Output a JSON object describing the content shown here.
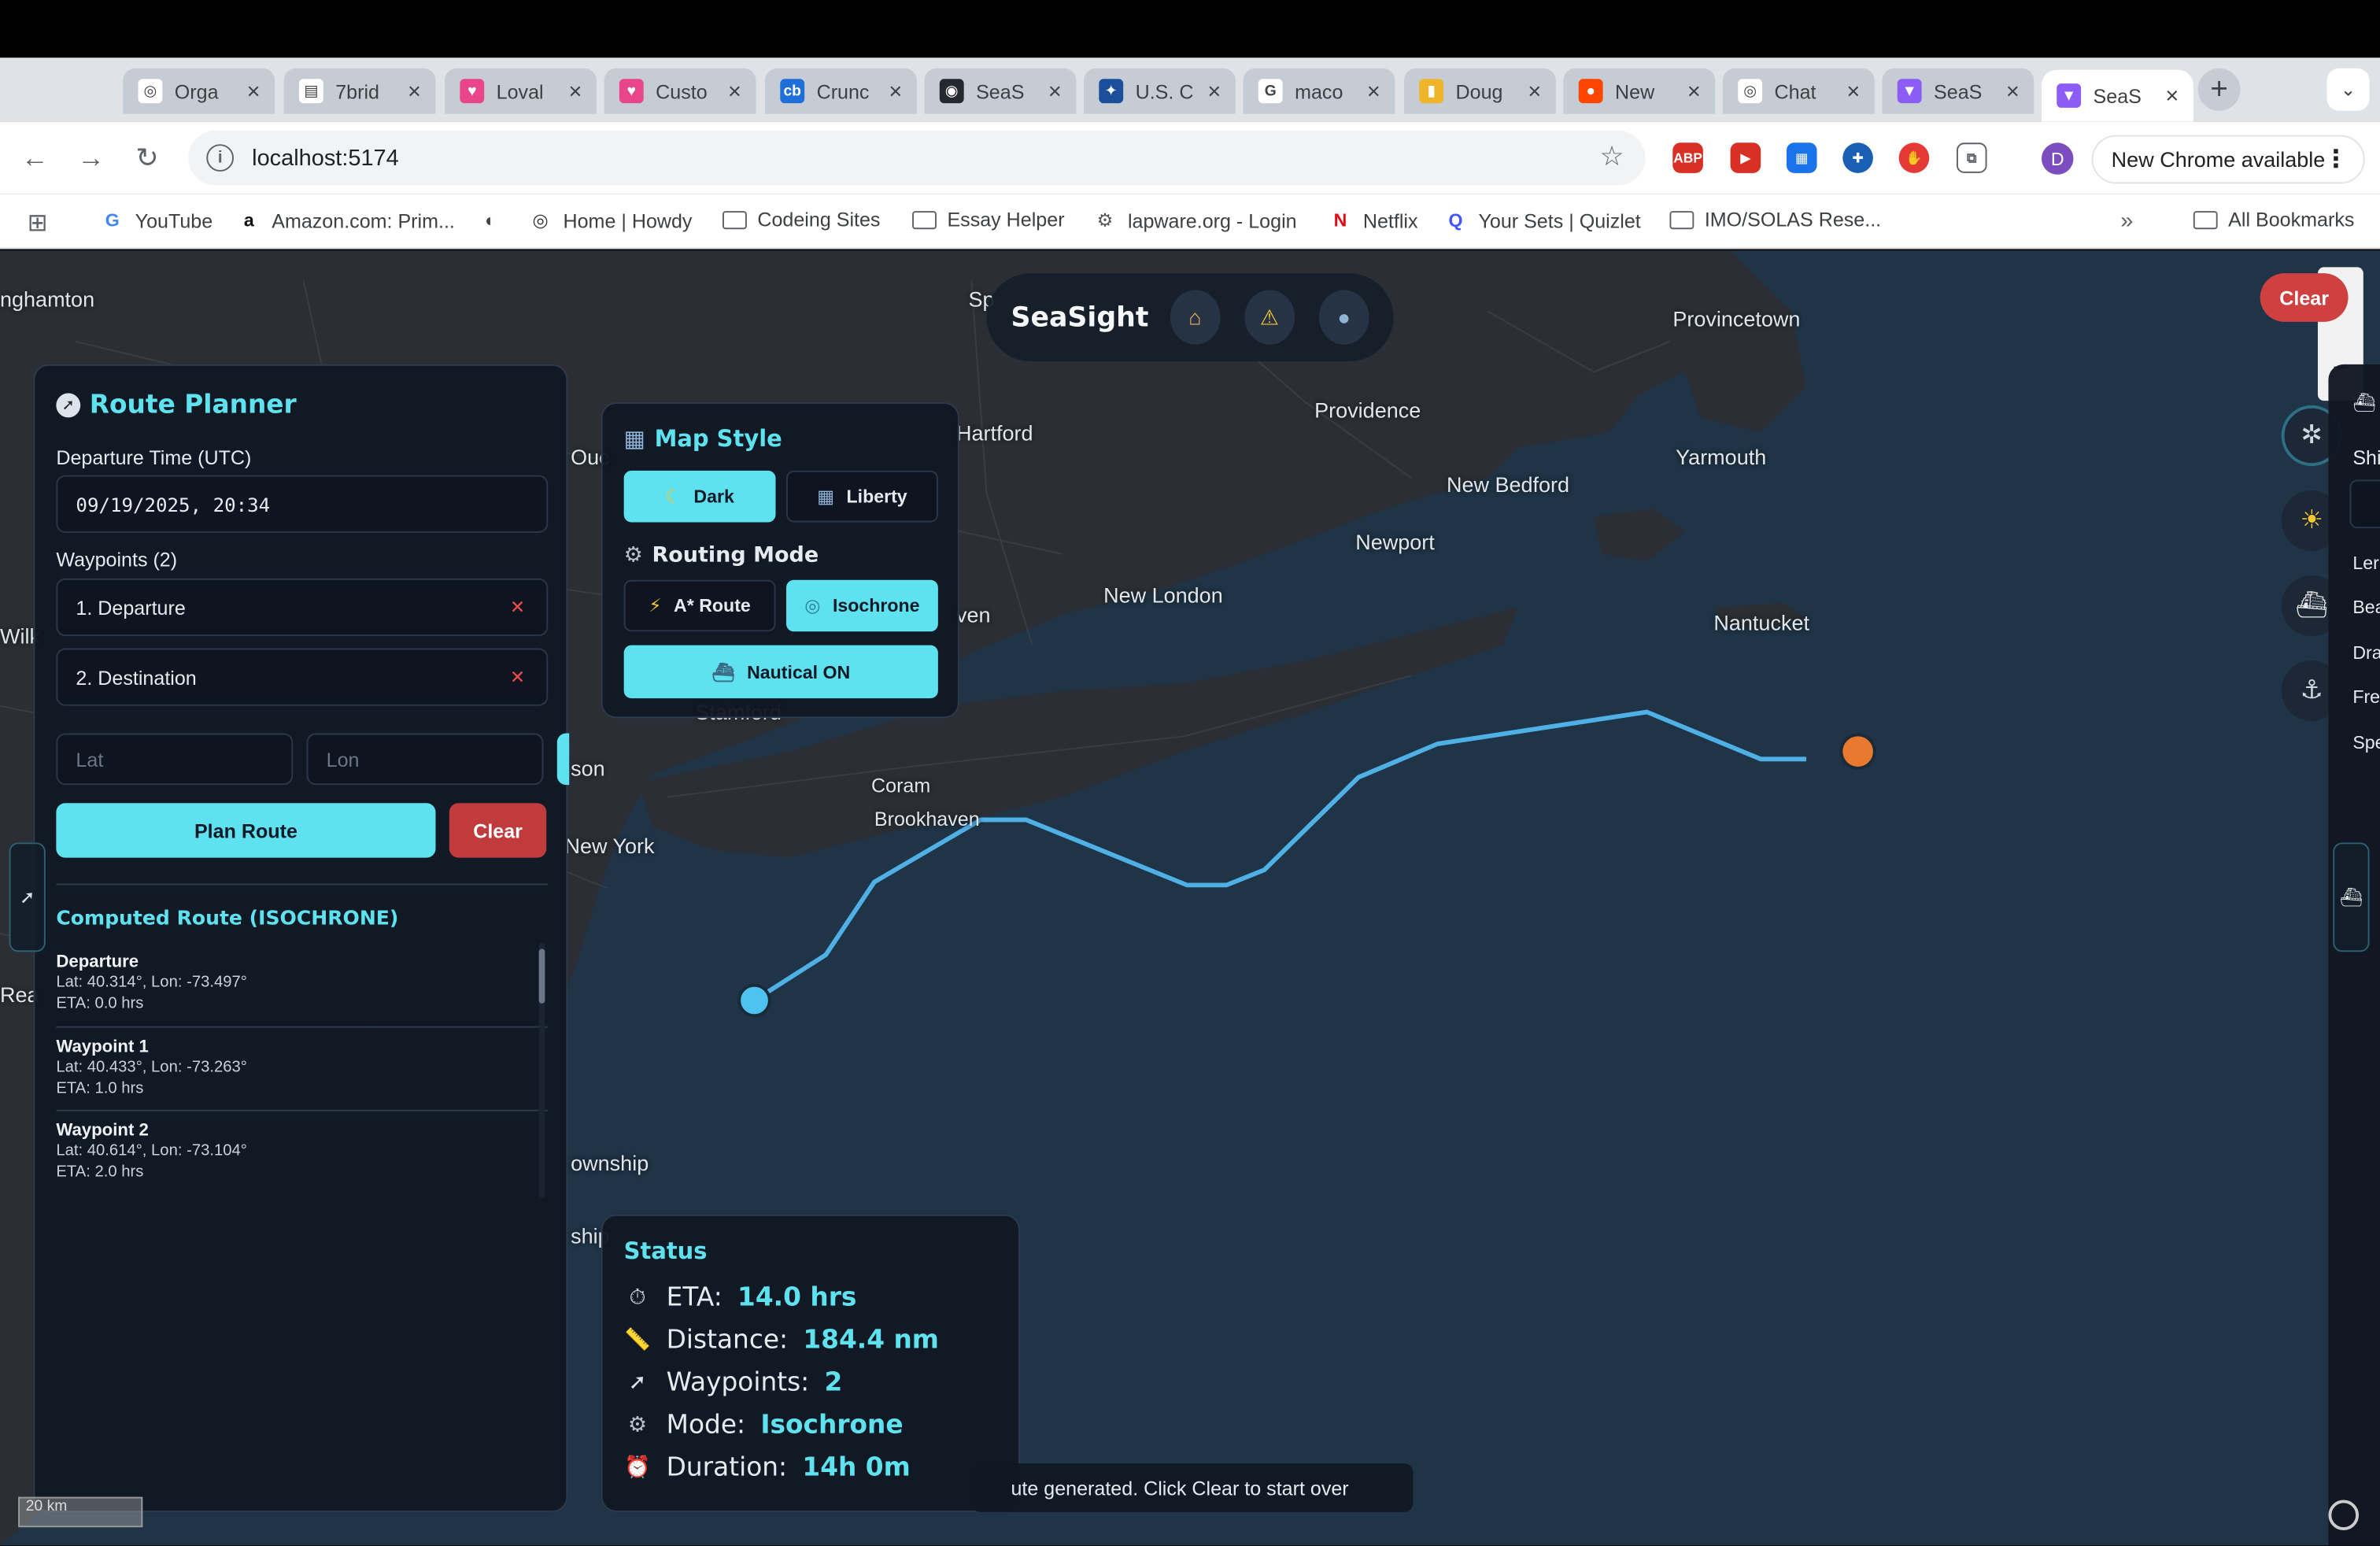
{
  "browser": {
    "tabs": [
      {
        "title": "Orga",
        "color": "#ffffff",
        "glyph": "◎"
      },
      {
        "title": "7brid",
        "color": "#ffffff",
        "glyph": "▤"
      },
      {
        "title": "Loval",
        "color": "#e8458b",
        "glyph": "♥"
      },
      {
        "title": "Custo",
        "color": "#e8458b",
        "glyph": "♥"
      },
      {
        "title": "Crunc",
        "color": "#1f6fd9",
        "glyph": "cb"
      },
      {
        "title": "SeaS",
        "color": "#24292f",
        "glyph": "◉"
      },
      {
        "title": "U.S. C",
        "color": "#1b4f9c",
        "glyph": "✦"
      },
      {
        "title": "maco",
        "color": "#ffffff",
        "glyph": "G"
      },
      {
        "title": "Doug",
        "color": "#f0b429",
        "glyph": "▮"
      },
      {
        "title": "New",
        "color": "#ff4500",
        "glyph": "●"
      },
      {
        "title": "Chat",
        "color": "#ffffff",
        "glyph": "◎"
      },
      {
        "title": "SeaS",
        "color": "#8b5cf6",
        "glyph": "▼"
      },
      {
        "title": "SeaS",
        "color": "#8b5cf6",
        "glyph": "▼"
      }
    ],
    "url": "localhost:5174",
    "new_chrome_label": "New Chrome available",
    "profile_initial": "D",
    "bookmarks": [
      {
        "label": "YouTube",
        "icon": "G"
      },
      {
        "label": "Amazon.com: Prim...",
        "icon": "a"
      },
      {
        "label": "",
        "icon": "◐"
      },
      {
        "label": "Home | Howdy",
        "icon": "◎"
      },
      {
        "label": "Codeing Sites",
        "icon": "folder"
      },
      {
        "label": "Essay Helper",
        "icon": "folder"
      },
      {
        "label": "lapware.org - Login",
        "icon": "⚙"
      },
      {
        "label": "Netflix",
        "icon": "N"
      },
      {
        "label": "Your Sets | Quizlet",
        "icon": "Q"
      },
      {
        "label": "IMO/SOLAS Rese...",
        "icon": "folder"
      }
    ],
    "all_bookmarks_label": "All Bookmarks"
  },
  "map": {
    "labels": [
      "nghamton",
      "Provincetown",
      "Providence",
      "Hartford",
      "Yarmouth",
      "New Bedford",
      "Newport",
      "New London",
      "Nantucket",
      "Coram",
      "Brookhaven",
      "New York",
      "Stamford",
      "Sp",
      "ven",
      "son",
      "Ouc",
      "Wilk",
      "Rea",
      "ownship",
      "ship"
    ],
    "scale_label": "20 km"
  },
  "app": {
    "brand": "SeaSight",
    "header_icons": [
      "home-icon",
      "warning-icon",
      "user-icon"
    ],
    "clear_pill": "Clear",
    "planner": {
      "title": "Route Planner",
      "departure_label": "Departure Time (UTC)",
      "departure_value": "09/19/2025, 20:34",
      "waypoints_label": "Waypoints (2)",
      "waypoints": [
        "1. Departure",
        "2. Destination"
      ],
      "lat_placeholder": "Lat",
      "lon_placeholder": "Lon",
      "plan_button": "Plan Route",
      "clear_button": "Clear",
      "computed_title": "Computed Route (ISOCHRONE)",
      "route_points": [
        {
          "name": "Departure",
          "coords": "Lat: 40.314°, Lon: -73.497°",
          "eta": "ETA: 0.0 hrs"
        },
        {
          "name": "Waypoint 1",
          "coords": "Lat: 40.433°, Lon: -73.263°",
          "eta": "ETA: 1.0 hrs"
        },
        {
          "name": "Waypoint 2",
          "coords": "Lat: 40.614°, Lon: -73.104°",
          "eta": "ETA: 2.0 hrs"
        }
      ]
    },
    "map_style": {
      "title": "Map Style",
      "styles": [
        {
          "label": "Dark",
          "active": true
        },
        {
          "label": "Liberty",
          "active": false
        }
      ],
      "routing_title": "Routing Mode",
      "modes": [
        {
          "label": "A* Route",
          "active": false
        },
        {
          "label": "Isochrone",
          "active": true
        }
      ],
      "nautical_button": "Nautical ON"
    },
    "status": {
      "title": "Status",
      "rows": [
        {
          "label": "ETA:",
          "value": "14.0 hrs",
          "icon": "stopwatch-icon"
        },
        {
          "label": "Distance:",
          "value": "184.4 nm",
          "icon": "ruler-icon"
        },
        {
          "label": "Waypoints:",
          "value": "2",
          "icon": "compass-icon"
        },
        {
          "label": "Mode:",
          "value": "Isochrone",
          "icon": "gear-icon"
        },
        {
          "label": "Duration:",
          "value": "14h 0m",
          "icon": "alarm-clock-icon"
        }
      ]
    },
    "toast": "ute generated. Click Clear to start over",
    "right_panel_labels": [
      "Shi",
      "Ler",
      "Bea",
      "Dra",
      "Fre",
      "Spe"
    ],
    "colors": {
      "accent": "#5ee2f0",
      "danger": "#cf4141",
      "route": "#4fb0e6",
      "destination": "#e8792e"
    }
  }
}
